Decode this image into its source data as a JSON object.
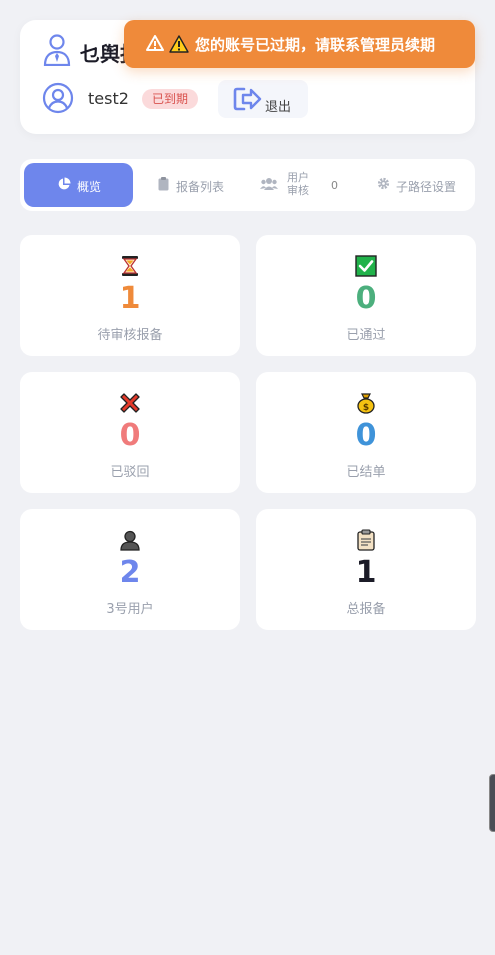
{
  "header": {
    "brand_title": "乜舆报",
    "username": "test2",
    "status_badge": "已到期",
    "logout_label": "退出"
  },
  "toast": {
    "message": "您的账号已过期，请联系管理员续期"
  },
  "tabs": {
    "overview": "概览",
    "report_list": "报备列表",
    "user_review": "用户审核",
    "user_review_count": "0",
    "subpath_settings": "子路径设置"
  },
  "stats": [
    {
      "value": "1",
      "caption": "待审核报备",
      "color": "#ef8a3a",
      "icon": "hourglass-icon"
    },
    {
      "value": "0",
      "caption": "已通过",
      "color": "#4caf7d",
      "icon": "check-box-icon"
    },
    {
      "value": "0",
      "caption": "已驳回",
      "color": "#f07b7b",
      "icon": "cross-icon"
    },
    {
      "value": "0",
      "caption": "已结单",
      "color": "#3f93d9",
      "icon": "money-bag-icon"
    },
    {
      "value": "2",
      "caption": "3号用户",
      "color": "#6e86ec",
      "icon": "user-silhouette-icon"
    },
    {
      "value": "1",
      "caption": "总报备",
      "color": "#1c1c28",
      "icon": "clipboard-icon"
    }
  ]
}
